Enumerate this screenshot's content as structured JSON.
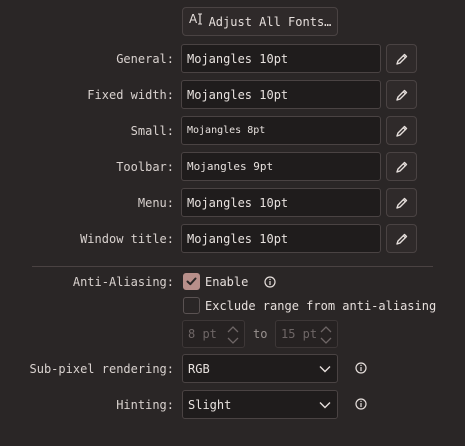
{
  "adjust_fonts": {
    "glyph": "A⃞",
    "label": "Adjust All Fonts…"
  },
  "font_rows": [
    {
      "label": "General:",
      "value": "Mojangles 10pt"
    },
    {
      "label": "Fixed width:",
      "value": "Mojangles 10pt"
    },
    {
      "label": "Small:",
      "value": "Mojangles 8pt"
    },
    {
      "label": "Toolbar:",
      "value": "Mojangles 9pt"
    },
    {
      "label": "Menu:",
      "value": "Mojangles 10pt"
    },
    {
      "label": "Window title:",
      "value": "Mojangles 10pt"
    }
  ],
  "antialiasing": {
    "label": "Anti-Aliasing:",
    "enable_label": "Enable",
    "enable_checked": true,
    "exclude_label": "Exclude range from anti-aliasing",
    "exclude_checked": false,
    "range_from": "8 pt",
    "range_to_label": "to",
    "range_to": "15 pt"
  },
  "subpixel": {
    "label": "Sub-pixel rendering:",
    "value": "RGB"
  },
  "hinting": {
    "label": "Hinting:",
    "value": "Slight"
  },
  "colors": {
    "background": "#2a2626",
    "accent": "#b88f8a",
    "field_bg": "#1f1c1c",
    "border": "#4a4343"
  },
  "icons": {
    "edit": "pencil-icon",
    "info": "info-icon",
    "chevron": "chevron-down-icon",
    "spin": "spin-arrows-icon",
    "check": "checkmark-icon"
  }
}
